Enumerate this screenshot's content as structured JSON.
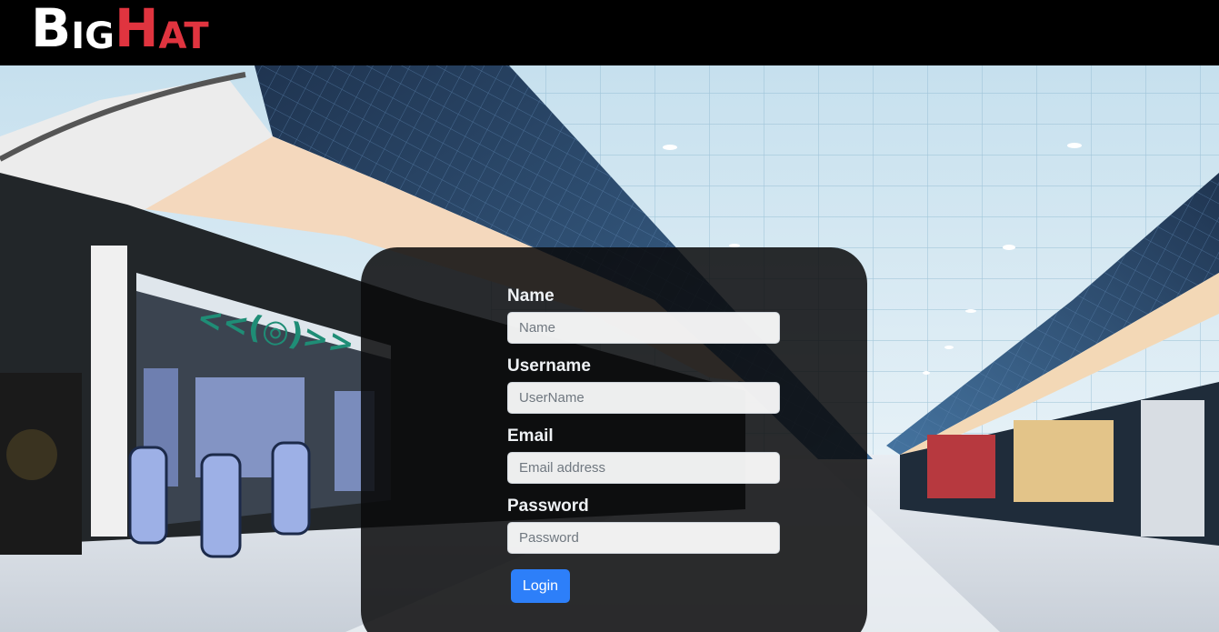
{
  "header": {
    "logo": {
      "part1_big": "B",
      "part1_small": "IG",
      "part2_big": "H",
      "part2_small": "AT",
      "colors": {
        "white": "#ffffff",
        "red": "#e0343f"
      }
    }
  },
  "login_form": {
    "fields": [
      {
        "label": "Name",
        "placeholder": "Name",
        "value": ""
      },
      {
        "label": "Username",
        "placeholder": "UserName",
        "value": ""
      },
      {
        "label": "Email",
        "placeholder": "Email address",
        "value": ""
      },
      {
        "label": "Password",
        "placeholder": "Password",
        "value": ""
      }
    ],
    "submit_label": "Login"
  },
  "background": {
    "description_colors": {
      "ceiling": "#b9d6e6",
      "blue_panels": "#3a5f8a",
      "floor": "#d7dde4",
      "accent": "#2d7ff9"
    }
  }
}
